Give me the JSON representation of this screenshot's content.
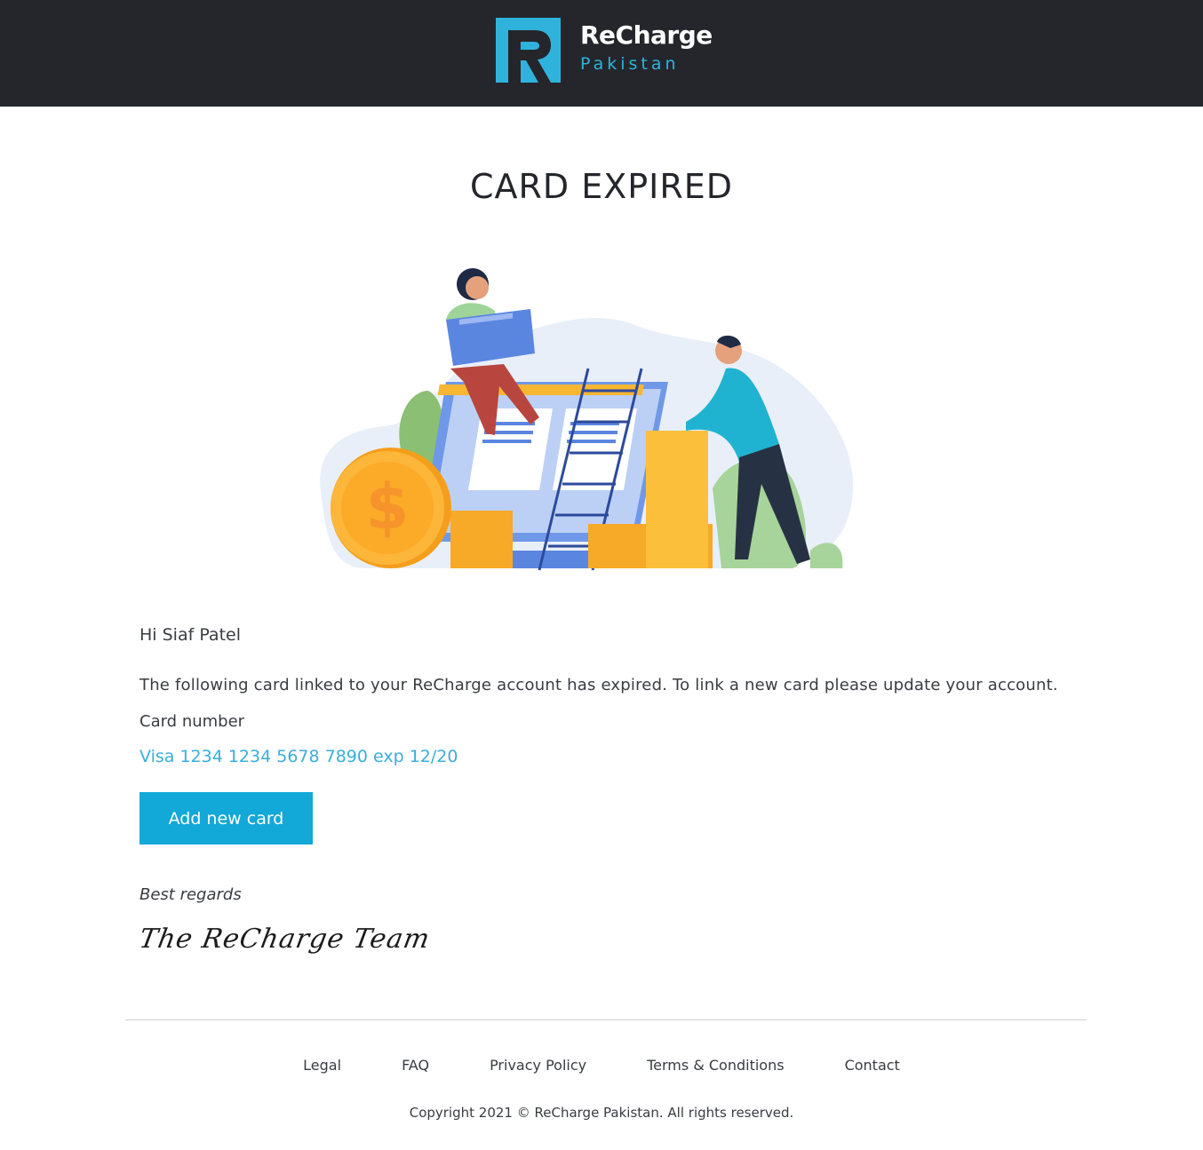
{
  "header": {
    "brand": "ReCharge",
    "sub_brand": "Pakistan",
    "logo_icon": "recharge-r-logo",
    "accent_color": "#2fb3dc",
    "background_color": "#24262b"
  },
  "main": {
    "title": "CARD EXPIRED",
    "illustration": "payment-card-illustration",
    "greeting": "Hi Siaf Patel",
    "message": "The following card linked to your ReCharge account has expired. To link a new card please update your account.",
    "card_label": "Card number",
    "card_value": "Visa 1234 1234 5678 7890 exp 12/20",
    "button_label": "Add new card",
    "button_color": "#12a8d8",
    "regards": "Best regards",
    "signature": "The ReCharge Team"
  },
  "footer": {
    "links": [
      "Legal",
      "FAQ",
      "Privacy Policy",
      "Terms & Conditions",
      "Contact"
    ],
    "copyright": "Copyright 2021 © ReCharge Pakistan. All rights reserved."
  }
}
